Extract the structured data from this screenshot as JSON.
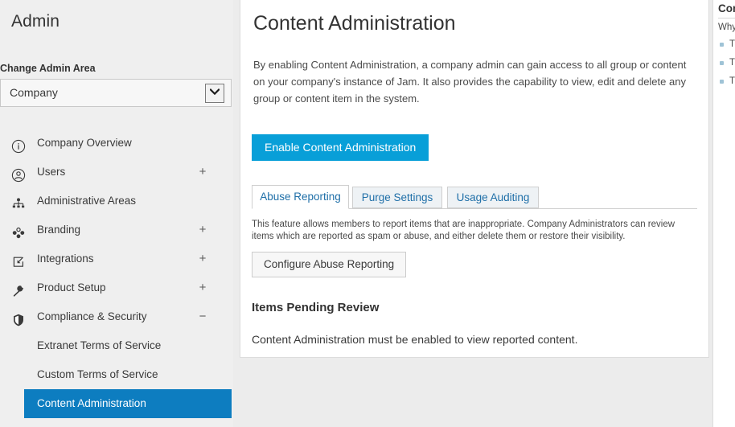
{
  "sidebar": {
    "title": "Admin",
    "change_area_label": "Change Admin Area",
    "area_select": {
      "value": "Company",
      "arrow_icon": "chevron-down-icon"
    },
    "items": [
      {
        "label": "Company Overview",
        "icon": "info-circle-icon",
        "toggle": ""
      },
      {
        "label": "Users",
        "icon": "user-circle-icon",
        "toggle": "+"
      },
      {
        "label": "Administrative Areas",
        "icon": "org-chart-icon",
        "toggle": ""
      },
      {
        "label": "Branding",
        "icon": "palette-dots-icon",
        "toggle": "+"
      },
      {
        "label": "Integrations",
        "icon": "integration-box-icon",
        "toggle": "+"
      },
      {
        "label": "Product Setup",
        "icon": "wrench-icon",
        "toggle": "+"
      },
      {
        "label": "Compliance & Security",
        "icon": "shield-icon",
        "toggle": "−"
      }
    ],
    "sub_items": [
      {
        "label": "Extranet Terms of Service",
        "selected": false
      },
      {
        "label": "Custom Terms of Service",
        "selected": false
      },
      {
        "label": "Content Administration",
        "selected": true
      }
    ]
  },
  "main": {
    "heading": "Content Administration",
    "intro": "By enabling Content Administration, a company admin can gain access to all group or content on your company's instance of Jam. It also provides the capability to view, edit and delete any group or content item in the system.",
    "enable_button": "Enable Content Administration",
    "tabs": [
      {
        "label": "Abuse Reporting",
        "active": true
      },
      {
        "label": "Purge Settings",
        "active": false
      },
      {
        "label": "Usage Auditing",
        "active": false
      }
    ],
    "tab_description": "This feature allows members to report items that are inappropriate. Company Administrators can review items which are reported as spam or abuse, and either delete them or restore their visibility.",
    "configure_button": "Configure Abuse Reporting",
    "pending_heading": "Items Pending Review",
    "pending_text": "Content Administration must be enabled to view reported content."
  },
  "right_rail": {
    "title": "Con",
    "subtitle": "Why",
    "items": [
      "T\nP",
      "T\nP",
      "T\nc"
    ]
  },
  "colors": {
    "accent_blue": "#089fd8",
    "selected_blue": "#0d7dc0",
    "tab_link_blue": "#1f6fa8",
    "sidebar_bg": "#efefef",
    "page_bg": "#ececec"
  }
}
